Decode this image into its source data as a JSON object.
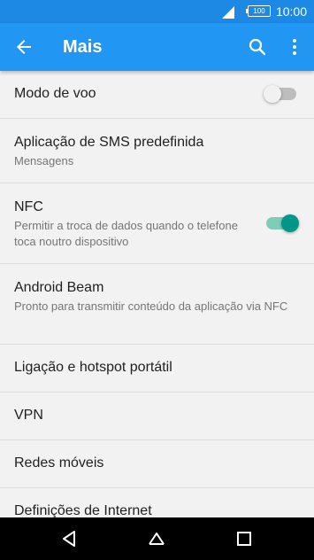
{
  "status_bar": {
    "time": "10:00",
    "battery": "100"
  },
  "app_bar": {
    "title": "Mais"
  },
  "items": [
    {
      "label": "Modo de voo",
      "sub": ""
    },
    {
      "label": "Aplicação de SMS predefinida",
      "sub": "Mensagens"
    },
    {
      "label": "NFC",
      "sub": "Permitir a troca de dados quando o telefone toca noutro dispositivo"
    },
    {
      "label": "Android Beam",
      "sub": "Pronto para transmitir conteúdo da aplicação via NFC"
    },
    {
      "label": "Ligação e hotspot portátil",
      "sub": ""
    },
    {
      "label": "VPN",
      "sub": ""
    },
    {
      "label": "Redes móveis",
      "sub": ""
    },
    {
      "label": "Definições de Internet",
      "sub": ""
    }
  ],
  "toggles": {
    "airplane_mode": false,
    "nfc": true
  },
  "colors": {
    "status_bar": "#1e88e5",
    "app_bar": "#2196f3",
    "accent": "#009688"
  },
  "icons": [
    "signal-icon",
    "battery-icon",
    "back-arrow-icon",
    "search-icon",
    "more-vert-icon",
    "nav-back-icon",
    "nav-home-icon",
    "nav-recents-icon"
  ]
}
